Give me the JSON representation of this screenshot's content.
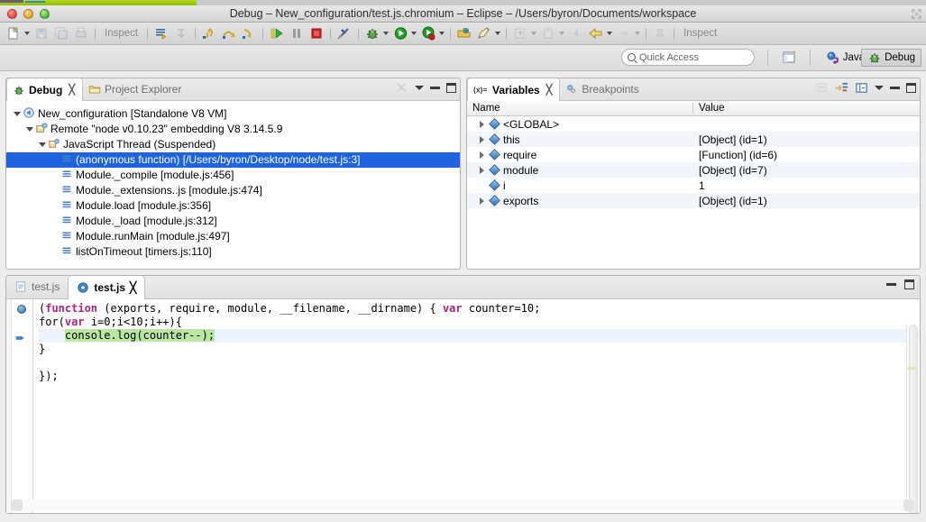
{
  "window": {
    "title": "Debug – New_configuration/test.js.chromium – Eclipse – /Users/byron/Documents/workspace",
    "traffic_lights": [
      "close",
      "minimize",
      "zoom"
    ]
  },
  "toolbar": {
    "inspect_label": "Inspect",
    "inspect_label_right": "Inspect",
    "buttons": [
      {
        "name": "new-wizard",
        "icon": "new-file-icon",
        "dropdown": true
      },
      {
        "name": "save",
        "icon": "save-icon",
        "dim": true
      },
      {
        "name": "save-all",
        "icon": "save-all-icon",
        "dim": true
      },
      {
        "name": "print",
        "icon": "print-icon",
        "dim": true
      },
      {
        "name": "inspect-text",
        "icon": "inspect-label"
      },
      {
        "name": "skip-all-breakpoints",
        "icon": "skip-breakpoints-icon"
      },
      {
        "name": "next-annotation",
        "icon": "next-annotation-icon",
        "dim": true
      },
      {
        "name": "step-into",
        "icon": "step-into-icon"
      },
      {
        "name": "step-over",
        "icon": "step-over-icon"
      },
      {
        "name": "step-return",
        "icon": "step-return-icon"
      },
      {
        "name": "resume",
        "icon": "resume-icon"
      },
      {
        "name": "suspend",
        "icon": "suspend-icon"
      },
      {
        "name": "terminate",
        "icon": "terminate-icon"
      },
      {
        "name": "disconnect",
        "icon": "disconnect-icon"
      },
      {
        "name": "debug",
        "icon": "debug-bug-icon",
        "dropdown": true
      },
      {
        "name": "run",
        "icon": "run-green-play-icon",
        "dropdown": true
      },
      {
        "name": "coverage",
        "icon": "coverage-icon",
        "dropdown": true
      },
      {
        "name": "open-type",
        "icon": "open-type-icon"
      },
      {
        "name": "search",
        "icon": "search-pencil-icon",
        "dropdown": true
      },
      {
        "name": "next-edit",
        "icon": "next-edit-icon",
        "dim": true,
        "dropdown": true
      },
      {
        "name": "previous-edit",
        "icon": "prev-edit-icon",
        "dim": true,
        "dropdown": true
      },
      {
        "name": "back",
        "icon": "back-arrow-icon",
        "dim": true
      },
      {
        "name": "back-history",
        "icon": "back-yellow-arrow-icon",
        "dropdown": true
      },
      {
        "name": "forward-history",
        "icon": "forward-arrow-icon",
        "dim": true,
        "dropdown": true
      },
      {
        "name": "pin",
        "icon": "pin-icon",
        "dim": true
      }
    ]
  },
  "perspective": {
    "quick_access_placeholder": "Quick Access",
    "open_perspective_icon": "open-perspective-icon",
    "buttons": [
      {
        "label": "Java",
        "icon": "java-perspective-icon",
        "active": false
      },
      {
        "label": "Debug",
        "icon": "debug-perspective-icon",
        "active": true
      }
    ]
  },
  "debug_view": {
    "tabs": [
      {
        "label": "Debug",
        "icon": "debug-perspective-icon",
        "active": true,
        "closable": true
      },
      {
        "label": "Project Explorer",
        "icon": "folder-icon",
        "active": false,
        "closable": false
      }
    ],
    "controls": [
      "view-menu-icon",
      "minimize-icon",
      "maximize-icon"
    ],
    "tree": [
      {
        "depth": 0,
        "label": "New_configuration [Standalone V8 VM]",
        "icon": "launch-config-icon",
        "expanded": true,
        "selected": false
      },
      {
        "depth": 1,
        "label": "Remote \"node v0.10.23\" embedding V8 3.14.5.9",
        "icon": "debug-target-icon",
        "expanded": true,
        "selected": false
      },
      {
        "depth": 2,
        "label": "JavaScript Thread (Suspended)",
        "icon": "thread-icon",
        "expanded": true,
        "selected": false
      },
      {
        "depth": 3,
        "label": "(anonymous function) [/Users/byron/Desktop/node/test.js:3]",
        "icon": "stack-frame-icon",
        "expanded": false,
        "selected": true
      },
      {
        "depth": 3,
        "label": "Module._compile [module.js:456]",
        "icon": "stack-frame-icon",
        "expanded": false,
        "selected": false
      },
      {
        "depth": 3,
        "label": "Module._extensions..js [module.js:474]",
        "icon": "stack-frame-icon",
        "expanded": false,
        "selected": false
      },
      {
        "depth": 3,
        "label": "Module.load [module.js:356]",
        "icon": "stack-frame-icon",
        "expanded": false,
        "selected": false
      },
      {
        "depth": 3,
        "label": "Module._load [module.js:312]",
        "icon": "stack-frame-icon",
        "expanded": false,
        "selected": false
      },
      {
        "depth": 3,
        "label": "Module.runMain [module.js:497]",
        "icon": "stack-frame-icon",
        "expanded": false,
        "selected": false
      },
      {
        "depth": 3,
        "label": "listOnTimeout [timers.js:110]",
        "icon": "stack-frame-icon",
        "expanded": false,
        "selected": false
      }
    ]
  },
  "variables_view": {
    "tabs": [
      {
        "label": "Variables",
        "icon": "variables-icon",
        "active": true,
        "closable": true
      },
      {
        "label": "Breakpoints",
        "icon": "breakpoints-icon",
        "active": false,
        "closable": false
      }
    ],
    "controls": [
      "collapse-all-icon",
      "show-type-names-icon",
      "layout-icon",
      "view-menu-icon",
      "minimize-icon",
      "maximize-icon"
    ],
    "columns": [
      "Name",
      "Value"
    ],
    "rows": [
      {
        "name": "<GLOBAL>",
        "value": "",
        "expandable": true
      },
      {
        "name": "this",
        "value": "[Object]  (id=1)",
        "expandable": true
      },
      {
        "name": "require",
        "value": "[Function]  (id=6)",
        "expandable": true
      },
      {
        "name": "module",
        "value": "[Object]  (id=7)",
        "expandable": true
      },
      {
        "name": "i",
        "value": "1",
        "expandable": false
      },
      {
        "name": "exports",
        "value": "[Object]  (id=1)",
        "expandable": true
      }
    ]
  },
  "editor": {
    "tabs": [
      {
        "label": "test.js",
        "icon": "js-file-icon",
        "active": false,
        "closable": false
      },
      {
        "label": "test.js",
        "icon": "chromium-debug-icon",
        "active": true,
        "closable": true
      }
    ],
    "controls": [
      "minimize-icon",
      "maximize-icon"
    ],
    "gutter": {
      "breakpoint_icon": "breakpoint-dot-icon",
      "instruction_pointer_icon": "instruction-pointer-arrow-icon"
    },
    "code_lines": [
      {
        "text": "(function (exports, require, module, __filename, __dirname) { var counter=10;",
        "current": false
      },
      {
        "text": "for(var i=0;i<10;i++){",
        "current": false
      },
      {
        "text": "    console.log(counter--);",
        "current": true
      },
      {
        "text": "}",
        "current": false
      },
      {
        "text": "",
        "current": false
      },
      {
        "text": "});",
        "current": false
      }
    ],
    "highlight_text": "console.log(counter--);",
    "keywords": [
      "function",
      "var"
    ]
  },
  "colors": {
    "selection_blue": "#1f63e0",
    "highlight_green": "#b9e6a0",
    "current_line": "#eef4fb",
    "keyword_magenta": "#a8267a",
    "progress_green": "#9ecb0d"
  }
}
